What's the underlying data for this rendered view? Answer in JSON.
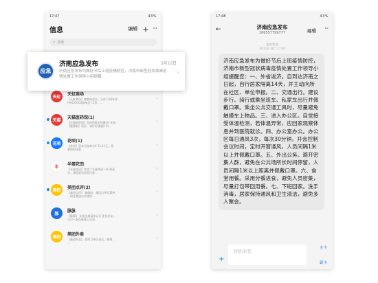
{
  "left": {
    "status": {
      "time": "17:47",
      "battery": "43%"
    },
    "header": {
      "title": "信息",
      "edit": "编辑",
      "plus": "+",
      "more": "···"
    },
    "search": {
      "placeholder": "搜索"
    },
    "popup": {
      "avatar": "应急",
      "name": "济南应急发布",
      "date": "3月10日",
      "preview": "济南应急发布为做好节后上班疫情防控，济南市新型冠状病毒疫情处置工作领导小组提醒："
    },
    "items": [
      {
        "avatar": "",
        "name": "",
        "preview1": "",
        "preview2": "",
        "color": "#e0e0e0",
        "dot": ""
      },
      {
        "avatar": "天虹",
        "name": "天虹商场",
        "preview1": "【天虹商场】尊敬的会员，天虹33周年庆",
        "preview2": "持AOOO00级单品7.5折，…",
        "color": "#e53935",
        "dot": ""
      },
      {
        "avatar": "天猫",
        "name": "天猫医药馆(1)",
        "preview1": "【天猫医药馆】您的药款300康(4) 相关",
        "preview2": "【健康助】您好，请好好康健(10)…",
        "color": "#e53935",
        "dot": "#1e88e5"
      },
      {
        "avatar": "花呗",
        "name": "花呗(1)",
        "preview1": "【花呗】您本月账单为¥ 31.41元，您",
        "preview2": "要按时还款…",
        "color": "#1677ff",
        "dot": "#1e88e5"
      },
      {
        "avatar": "半",
        "name": "半蛋花田",
        "preview1": "【半蛋花田】完成了半蛋花田一叶·佩面",
        "preview2": "分，请您收到消息注意…",
        "color": "#ffffff",
        "dot": ""
      },
      {
        "avatar": "美团",
        "name": "美团点评(2)",
        "preview1": "【美团点评】 尊敬的，美团点评优惠券",
        "preview2": "…前往美团点评使用…",
        "color": "#ffc300",
        "dot": "#1e88e5"
      },
      {
        "avatar": "脉",
        "name": "脉脉",
        "preview1": "【脉脉】 孙佳佳邀请你认识 更多好友…",
        "preview2": "认识一起在脉脉上交流…",
        "color": "#1f6fe0",
        "dot": ""
      },
      {
        "avatar": "美团",
        "name": "美团外卖",
        "preview1": "【美团外卖】 您的订单已送达，感谢…",
        "preview2": "…",
        "color": "#ffc300",
        "dot": ""
      }
    ]
  },
  "right": {
    "status": {
      "time": "17:48",
      "battery": "43%"
    },
    "header": {
      "back": "←",
      "name": "济南应急发布",
      "number": "106557799777",
      "edit": "编辑",
      "more": "···"
    },
    "meta": {
      "line1": "短信/彩信",
      "line2": "3月10日 周二 17:00"
    },
    "message": "济南应急发布为做好节后上班疫情防控，济南市新型冠状病毒疫情处置工作领导小组提醒您：一、外省返济。自到达济南之日起，自行居家隔离14天，并主动向所在社区、单位申报。二、交通出行。建议步行、骑行或乘坐班车、私家车出行并佩戴口罩。乘坐公共交通工具时，尽量避免触摸车上物品。三、进入办公区。自觉接受体温检测，若体温异常，应回家观察休息并到医院就诊。四、办公室办公。办公区每日通风3次，每次30分钟。开会控制会议时间，定时开窗通风，人员间隔1米以上并佩戴口罩。五、外出公务。避开密集人群，避免在公共场所长时间停留，人员间隔1米以上距离并佩戴口罩。六、食堂用餐。采用分餐进食，避免人员密集，尽量打包带回用餐。七、下班回家。洗手消毒，居家保持通风和卫生清洁，避免多人聚会。",
    "compose": {
      "plus": "+",
      "placeholder": "短信/彩信",
      "card1": "主卡",
      "card2": "副卡"
    }
  }
}
